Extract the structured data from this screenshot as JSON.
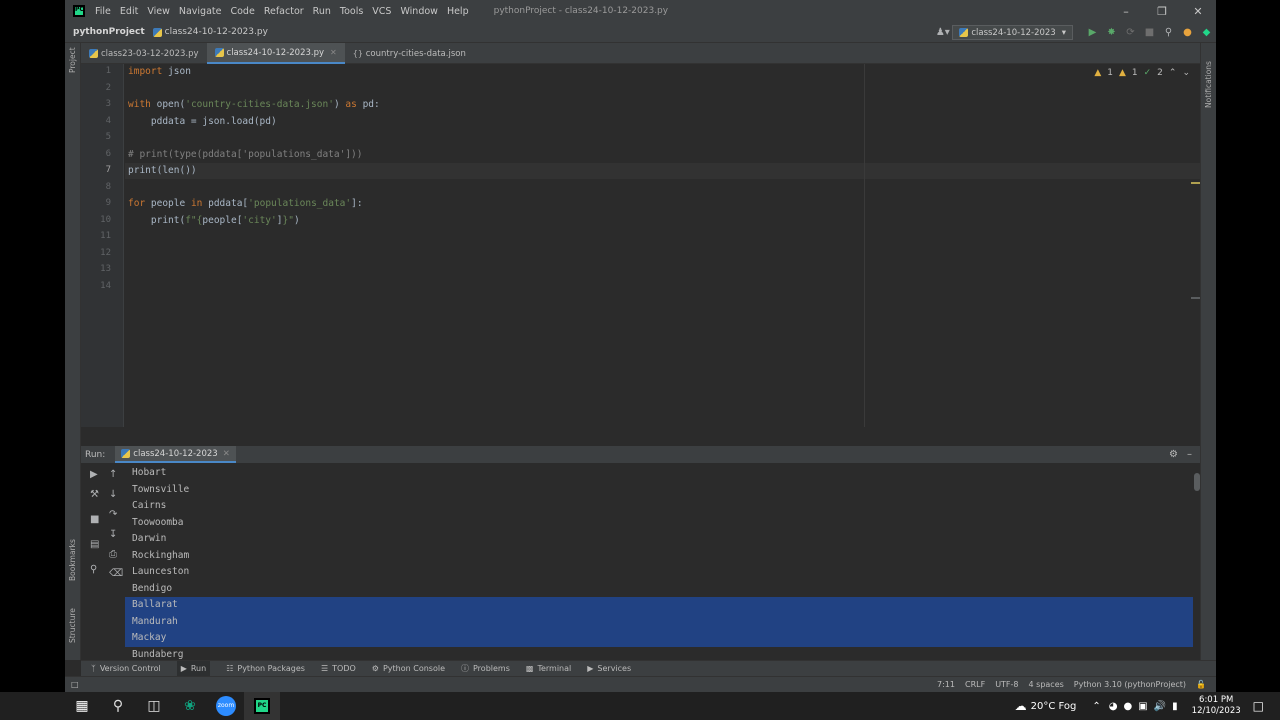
{
  "titlebar": {
    "menus": [
      "File",
      "Edit",
      "View",
      "Navigate",
      "Code",
      "Refactor",
      "Run",
      "Tools",
      "VCS",
      "Window",
      "Help"
    ],
    "window_title": "pythonProject - class24-10-12-2023.py"
  },
  "navbar": {
    "project": "pythonProject",
    "file": "class24-10-12-2023.py",
    "run_config": "class24-10-12-2023"
  },
  "tabs": [
    {
      "label": "class23-03-12-2023.py"
    },
    {
      "label": "class24-10-12-2023.py"
    },
    {
      "label": "country-cities-data.json"
    }
  ],
  "left_strip": {
    "project": "Project",
    "bookmarks": "Bookmarks",
    "structure": "Structure"
  },
  "right_strip": {
    "notifications": "Notifications"
  },
  "editor": {
    "inspections": {
      "warnings_a": "1",
      "warnings_b": "1",
      "ok": "2"
    },
    "line_numbers": [
      "1",
      "2",
      "3",
      "4",
      "5",
      "6",
      "7",
      "8",
      "9",
      "10",
      "11",
      "12",
      "13",
      "14"
    ],
    "current_line": 7,
    "lines": {
      "l1_kw": "import",
      "l1_rest": " json",
      "l3_kw": "with",
      "l3_a": " open(",
      "l3_str": "'country-cities-data.json'",
      "l3_b": ") ",
      "l3_kw2": "as",
      "l3_c": " pd:",
      "l4": "    pddata = json.load(pd)",
      "l6": "# print(type(pddata['populations_data']))",
      "l7": "print(len())",
      "l9_kw": "for",
      "l9_a": " people ",
      "l9_kw2": "in",
      "l9_b": " pddata[",
      "l9_str": "'populations_data'",
      "l9_c": "]:",
      "l10_a": "    print(",
      "l10_str1": "f\"{",
      "l10_b": "people[",
      "l10_str2": "'city'",
      "l10_c": "]",
      "l10_str3": "}\"",
      "l10_d": ")"
    }
  },
  "run": {
    "label": "Run:",
    "tab": "class24-10-12-2023",
    "output": [
      "Hobart",
      "Townsville",
      "Cairns",
      "Toowoomba",
      "Darwin",
      "Rockingham",
      "Launceston",
      "Bendigo",
      "Ballarat",
      "Mandurah",
      "Mackay",
      "Bundaberg"
    ],
    "selected": [
      8,
      9,
      10
    ]
  },
  "tool_tabs": [
    "Version Control",
    "Run",
    "Python Packages",
    "TODO",
    "Python Console",
    "Problems",
    "Terminal",
    "Services"
  ],
  "status": {
    "position": "7:11",
    "line_sep": "CRLF",
    "encoding": "UTF-8",
    "indent": "4 spaces",
    "interpreter": "Python 3.10 (pythonProject)"
  },
  "taskbar": {
    "weather": "20°C  Fog",
    "time": "6:01 PM",
    "date": "12/10/2023",
    "zoom_label": "zoom",
    "pc_label": "PC"
  },
  "colors": {
    "selection": "#214283",
    "keyword": "#cc7832",
    "string": "#6a8759",
    "comment": "#808080"
  }
}
